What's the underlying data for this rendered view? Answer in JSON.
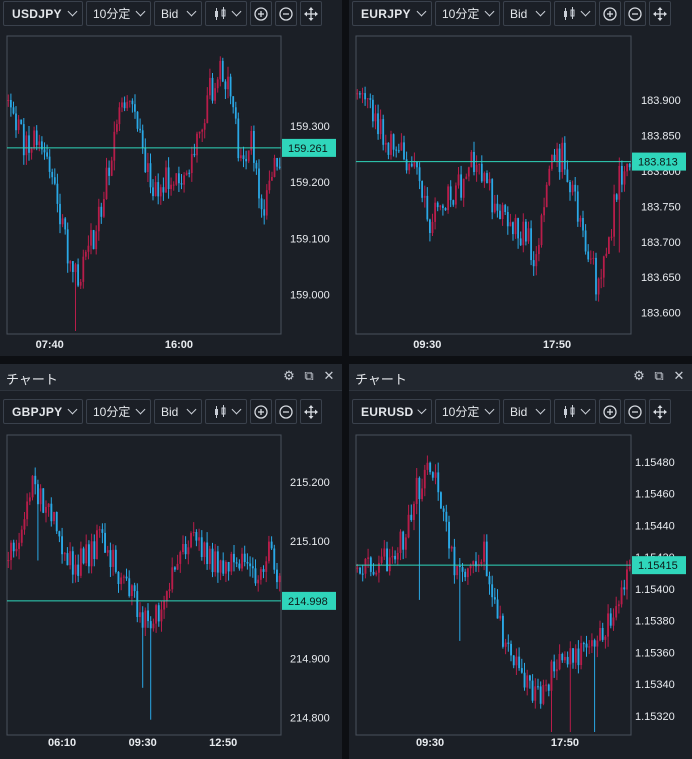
{
  "panels": [
    {
      "id": "usdjpy",
      "has_title_bar": false,
      "toolbar": {
        "symbol": "USDJPY",
        "timeframe": "10分定",
        "price_type": "Bid"
      },
      "colors": {
        "up": "#b81d4a",
        "down": "#2aa8e6",
        "current_line": "#2fd6bb",
        "badge": "#2fd6bb"
      }
    },
    {
      "id": "eurjpy",
      "has_title_bar": false,
      "toolbar": {
        "symbol": "EURJPY",
        "timeframe": "10分定",
        "price_type": "Bid"
      },
      "colors": {
        "up": "#b81d4a",
        "down": "#2aa8e6",
        "current_line": "#2fd6bb",
        "badge": "#2fd6bb"
      }
    },
    {
      "id": "gbpjpy",
      "has_title_bar": true,
      "title": "チャート",
      "toolbar": {
        "symbol": "GBPJPY",
        "timeframe": "10分定",
        "price_type": "Bid"
      },
      "colors": {
        "up": "#b81d4a",
        "down": "#2aa8e6",
        "current_line": "#2fd6bb",
        "badge": "#2fd6bb"
      }
    },
    {
      "id": "eurusd",
      "has_title_bar": true,
      "title": "チャート",
      "toolbar": {
        "symbol": "EURUSD",
        "timeframe": "10分定",
        "price_type": "Bid"
      },
      "colors": {
        "up": "#b81d4a",
        "down": "#2aa8e6",
        "current_line": "#2fd6bb",
        "badge": "#2fd6bb"
      }
    }
  ],
  "toolbar_icons": [
    "candlestick-icon",
    "zoom-in-icon",
    "zoom-out-icon",
    "move-icon"
  ],
  "title_bar_icons": [
    "gear-icon",
    "popout-icon",
    "close-icon"
  ],
  "chart_data": [
    {
      "type": "candlestick",
      "symbol": "USDJPY",
      "ylim": [
        158.93,
        159.46
      ],
      "y_ticks": [
        159.3,
        159.2,
        159.1,
        159.0
      ],
      "y_tick_labels": [
        "159.300",
        "159.200",
        "159.100",
        "159.000"
      ],
      "x_tick_labels": [
        {
          "label": "07:40",
          "index": 16
        },
        {
          "label": "16:00",
          "index": 66
        }
      ],
      "current_price": 159.261,
      "current_price_label": "159.261",
      "grid": false,
      "seed": 11,
      "path": [
        [
          0,
          159.36
        ],
        [
          6,
          159.27
        ],
        [
          12,
          159.28
        ],
        [
          17,
          159.21
        ],
        [
          23,
          159.08
        ],
        [
          28,
          159.03
        ],
        [
          34,
          159.12
        ],
        [
          40,
          159.25
        ],
        [
          45,
          159.35
        ],
        [
          49,
          159.33
        ],
        [
          54,
          159.22
        ],
        [
          58,
          159.18
        ],
        [
          64,
          159.22
        ],
        [
          68,
          159.2
        ],
        [
          73,
          159.28
        ],
        [
          78,
          159.36
        ],
        [
          82,
          159.4
        ],
        [
          86,
          159.35
        ],
        [
          90,
          159.24
        ],
        [
          94,
          159.27
        ],
        [
          98,
          159.13
        ],
        [
          102,
          159.23
        ],
        [
          105,
          159.24
        ]
      ],
      "count": 106
    },
    {
      "type": "candlestick",
      "symbol": "EURJPY",
      "ylim": [
        183.57,
        183.99
      ],
      "y_ticks": [
        183.9,
        183.85,
        183.8,
        183.75,
        183.7,
        183.65,
        183.6
      ],
      "y_tick_labels": [
        "183.900",
        "183.850",
        "183.800",
        "183.750",
        "183.700",
        "183.650",
        "183.600"
      ],
      "x_tick_labels": [
        {
          "label": "09:30",
          "index": 27
        },
        {
          "label": "17:50",
          "index": 77
        }
      ],
      "current_price": 183.813,
      "current_price_label": "183.813",
      "grid": false,
      "seed": 23,
      "path": [
        [
          0,
          183.92
        ],
        [
          6,
          183.88
        ],
        [
          11,
          183.84
        ],
        [
          16,
          183.84
        ],
        [
          22,
          183.8
        ],
        [
          28,
          183.73
        ],
        [
          34,
          183.76
        ],
        [
          40,
          183.78
        ],
        [
          46,
          183.82
        ],
        [
          52,
          183.76
        ],
        [
          58,
          183.74
        ],
        [
          64,
          183.71
        ],
        [
          69,
          183.68
        ],
        [
          74,
          183.8
        ],
        [
          79,
          183.82
        ],
        [
          84,
          183.75
        ],
        [
          89,
          183.69
        ],
        [
          93,
          183.63
        ],
        [
          97,
          183.7
        ],
        [
          101,
          183.8
        ],
        [
          105,
          183.8
        ]
      ],
      "count": 106
    },
    {
      "type": "candlestick",
      "symbol": "GBPJPY",
      "ylim": [
        214.77,
        215.28
      ],
      "y_ticks": [
        215.2,
        215.1,
        214.9,
        214.8
      ],
      "y_tick_labels": [
        "215.200",
        "215.100",
        "214.900",
        "214.800"
      ],
      "x_tick_labels": [
        {
          "label": "06:10",
          "index": 20
        },
        {
          "label": "09:30",
          "index": 50
        },
        {
          "label": "12:50",
          "index": 80
        }
      ],
      "current_price": 214.998,
      "current_price_label": "214.998",
      "grid": false,
      "seed": 37,
      "path": [
        [
          0,
          215.08
        ],
        [
          5,
          215.13
        ],
        [
          9,
          215.2
        ],
        [
          14,
          215.16
        ],
        [
          19,
          215.11
        ],
        [
          24,
          215.05
        ],
        [
          29,
          215.07
        ],
        [
          34,
          215.11
        ],
        [
          39,
          215.06
        ],
        [
          44,
          215.04
        ],
        [
          48,
          214.98
        ],
        [
          52,
          214.95
        ],
        [
          57,
          214.99
        ],
        [
          62,
          215.07
        ],
        [
          67,
          215.1
        ],
        [
          72,
          215.08
        ],
        [
          77,
          215.06
        ],
        [
          82,
          215.07
        ],
        [
          87,
          215.06
        ],
        [
          92,
          215.05
        ],
        [
          97,
          215.08
        ],
        [
          101,
          215.02
        ]
      ],
      "count": 102
    },
    {
      "type": "candlestick",
      "symbol": "EURUSD",
      "ylim": [
        1.15308,
        1.15497
      ],
      "y_ticks": [
        1.1548,
        1.1546,
        1.1544,
        1.1542,
        1.154,
        1.1538,
        1.1536,
        1.1534,
        1.1532
      ],
      "y_tick_labels": [
        "1.15480",
        "1.15460",
        "1.15440",
        "1.15420",
        "1.15400",
        "1.15380",
        "1.15360",
        "1.15340",
        "1.15320"
      ],
      "x_tick_labels": [
        {
          "label": "09:30",
          "index": 27
        },
        {
          "label": "17:50",
          "index": 77
        }
      ],
      "current_price": 1.15415,
      "current_price_label": "1.15415",
      "grid": false,
      "seed": 53,
      "path": [
        [
          0,
          1.15418
        ],
        [
          6,
          1.15415
        ],
        [
          11,
          1.1542
        ],
        [
          17,
          1.15432
        ],
        [
          22,
          1.15462
        ],
        [
          27,
          1.15478
        ],
        [
          32,
          1.1545
        ],
        [
          37,
          1.1541
        ],
        [
          42,
          1.1542
        ],
        [
          47,
          1.15425
        ],
        [
          52,
          1.1538
        ],
        [
          57,
          1.1536
        ],
        [
          62,
          1.15345
        ],
        [
          67,
          1.1533
        ],
        [
          72,
          1.15345
        ],
        [
          77,
          1.15355
        ],
        [
          82,
          1.1536
        ],
        [
          87,
          1.15365
        ],
        [
          92,
          1.15375
        ],
        [
          97,
          1.15395
        ],
        [
          101,
          1.1542
        ]
      ],
      "count": 102
    }
  ]
}
